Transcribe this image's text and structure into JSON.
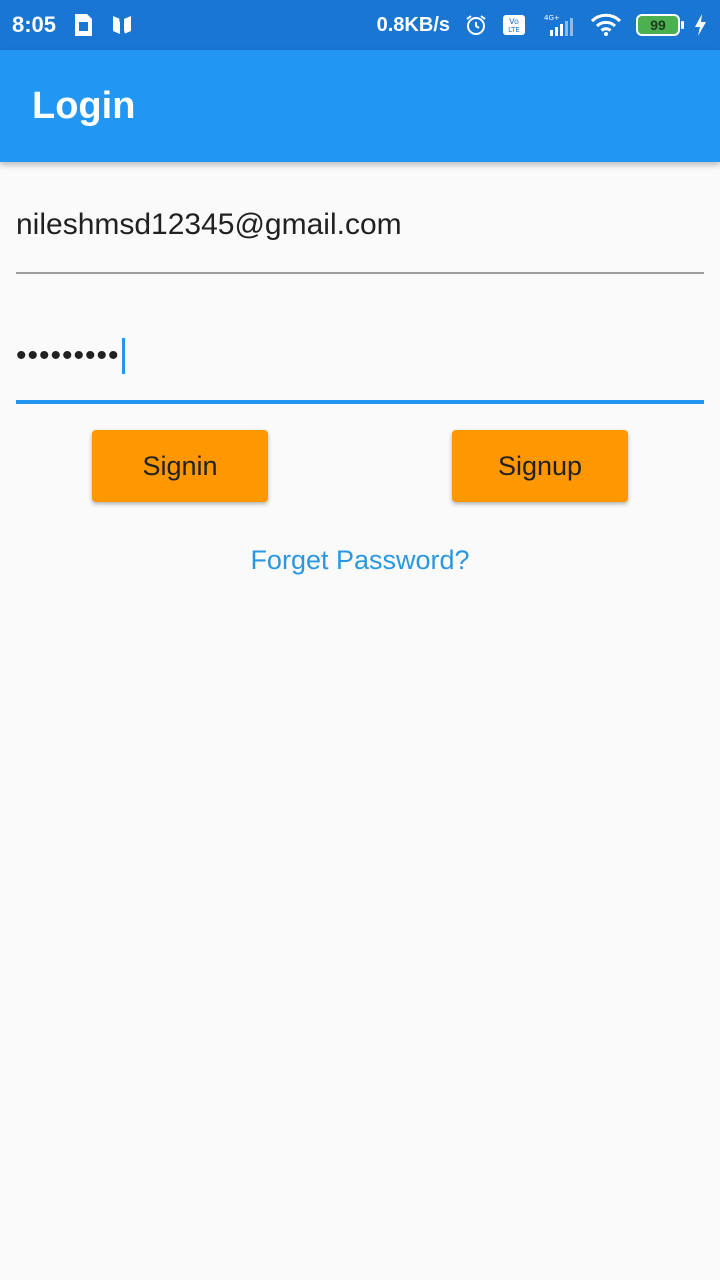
{
  "status_bar": {
    "time": "8:05",
    "net_speed": "0.8KB/s",
    "network_type": "4G+",
    "volte": "Vo LTE",
    "battery": "99",
    "icons": [
      "sim-card-icon",
      "n-notification-icon",
      "alarm-icon",
      "volte-icon",
      "signal-icon",
      "wifi-icon",
      "battery-icon",
      "charging-icon"
    ]
  },
  "app_bar": {
    "title": "Login"
  },
  "form": {
    "email_value": "nileshmsd12345@gmail.com",
    "password_value": "•••••••••"
  },
  "buttons": {
    "signin_label": "Signin",
    "signup_label": "Signup"
  },
  "links": {
    "forget_password": "Forget Password?"
  },
  "colors": {
    "status_bar": "#1976d2",
    "app_bar": "#2196f3",
    "button": "#ff9800",
    "link": "#2a98e0",
    "focus_underline": "#2196f3"
  }
}
